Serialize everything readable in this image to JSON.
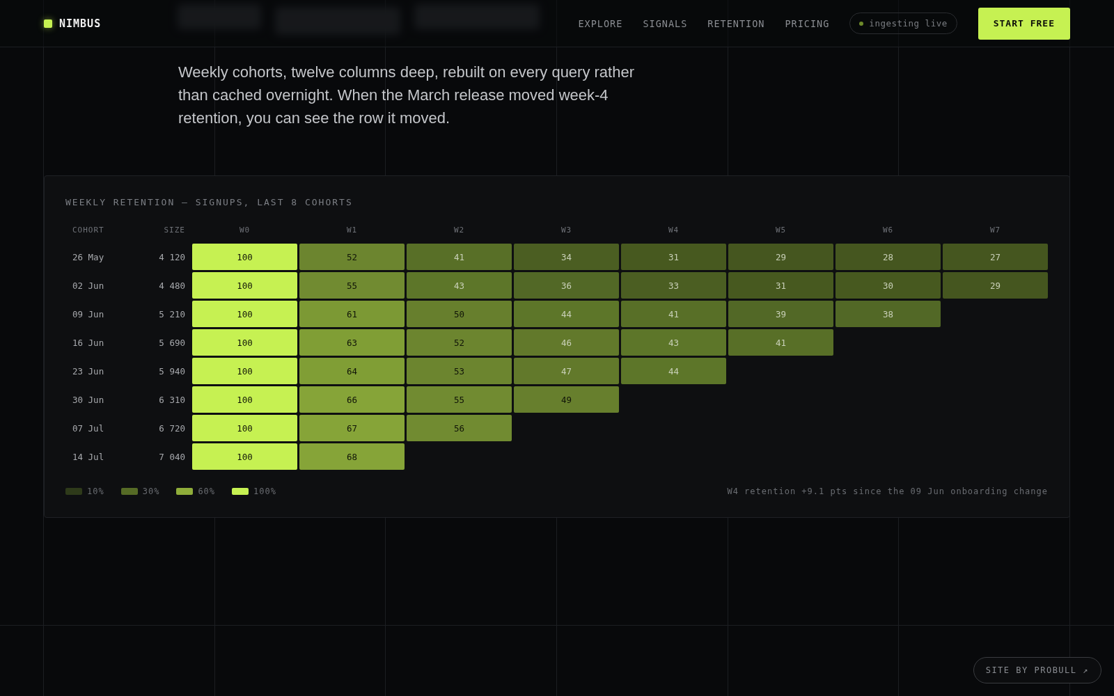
{
  "nav": {
    "brand": "NIMBUS",
    "links": [
      {
        "label": "EXPLORE"
      },
      {
        "label": "SIGNALS"
      },
      {
        "label": "RETENTION"
      },
      {
        "label": "PRICING"
      }
    ],
    "status": "ingesting live",
    "cta": "START FREE"
  },
  "intro": "Weekly cohorts, twelve columns deep, rebuilt on every query rather than cached overnight. When the March release moved week-4 retention, you can see the row it moved.",
  "panel": {
    "title": "WEEKLY RETENTION — SIGNUPS, LAST 8 COHORTS",
    "columns": [
      "COHORT",
      "SIZE",
      "W0",
      "W1",
      "W2",
      "W3",
      "W4",
      "W5",
      "W6",
      "W7"
    ],
    "rows": [
      {
        "cells": [
          {
            "value": "26 May"
          },
          {
            "value": "4 120"
          },
          {
            "value": "100",
            "color": "#c6f152"
          },
          {
            "value": "52",
            "color": "#6c852f"
          },
          {
            "value": "41",
            "color": "#586f27"
          },
          {
            "value": "34",
            "color": "#4b5e22"
          },
          {
            "value": "31",
            "color": "#47591f"
          },
          {
            "value": "29",
            "color": "#45561f"
          },
          {
            "value": "28",
            "color": "#45561f"
          },
          {
            "value": "27",
            "color": "#45561f"
          }
        ]
      },
      {
        "cells": [
          {
            "value": "02 Jun"
          },
          {
            "value": "4 480"
          },
          {
            "value": "100",
            "color": "#c6f152"
          },
          {
            "value": "55",
            "color": "#718b31"
          },
          {
            "value": "43",
            "color": "#5d7629"
          },
          {
            "value": "36",
            "color": "#526826"
          },
          {
            "value": "33",
            "color": "#4b5e22"
          },
          {
            "value": "31",
            "color": "#47591f"
          },
          {
            "value": "30",
            "color": "#47591f"
          },
          {
            "value": "29",
            "color": "#45561f"
          }
        ]
      },
      {
        "cells": [
          {
            "value": "09 Jun"
          },
          {
            "value": "5 210"
          },
          {
            "value": "100",
            "color": "#c6f152"
          },
          {
            "value": "61",
            "color": "#7c9934"
          },
          {
            "value": "50",
            "color": "#677f2d"
          },
          {
            "value": "44",
            "color": "#5d7629"
          },
          {
            "value": "41",
            "color": "#586f27"
          },
          {
            "value": "39",
            "color": "#526826"
          },
          {
            "value": "38",
            "color": "#526826"
          }
        ]
      },
      {
        "cells": [
          {
            "value": "16 Jun"
          },
          {
            "value": "5 690"
          },
          {
            "value": "100",
            "color": "#c6f152"
          },
          {
            "value": "63",
            "color": "#809e35"
          },
          {
            "value": "52",
            "color": "#6c852f"
          },
          {
            "value": "46",
            "color": "#62792b"
          },
          {
            "value": "43",
            "color": "#5d7629"
          },
          {
            "value": "41",
            "color": "#586f27"
          }
        ]
      },
      {
        "cells": [
          {
            "value": "23 Jun"
          },
          {
            "value": "5 940"
          },
          {
            "value": "100",
            "color": "#c6f152"
          },
          {
            "value": "64",
            "color": "#809e35"
          },
          {
            "value": "53",
            "color": "#6c852f"
          },
          {
            "value": "47",
            "color": "#62792b"
          },
          {
            "value": "44",
            "color": "#5d7629"
          }
        ]
      },
      {
        "cells": [
          {
            "value": "30 Jun"
          },
          {
            "value": "6 310"
          },
          {
            "value": "100",
            "color": "#c6f152"
          },
          {
            "value": "66",
            "color": "#86a438"
          },
          {
            "value": "55",
            "color": "#718b31"
          },
          {
            "value": "49",
            "color": "#677f2d"
          }
        ]
      },
      {
        "cells": [
          {
            "value": "07 Jul"
          },
          {
            "value": "6 720"
          },
          {
            "value": "100",
            "color": "#c6f152"
          },
          {
            "value": "67",
            "color": "#86a438"
          },
          {
            "value": "56",
            "color": "#718b31"
          }
        ]
      },
      {
        "cells": [
          {
            "value": "14 Jul"
          },
          {
            "value": "7 040"
          },
          {
            "value": "100",
            "color": "#c6f152"
          },
          {
            "value": "68",
            "color": "#86a438"
          }
        ]
      }
    ],
    "legend": [
      {
        "label": "10%",
        "color": "#2e3a1a"
      },
      {
        "label": "30%",
        "color": "#566b26"
      },
      {
        "label": "60%",
        "color": "#8fad3a"
      },
      {
        "label": "100%",
        "color": "#c6f152"
      }
    ],
    "note": "W4 retention +9.1 pts since the 09 Jun onboarding change"
  },
  "credit": "SITE BY PROBULL ↗"
}
